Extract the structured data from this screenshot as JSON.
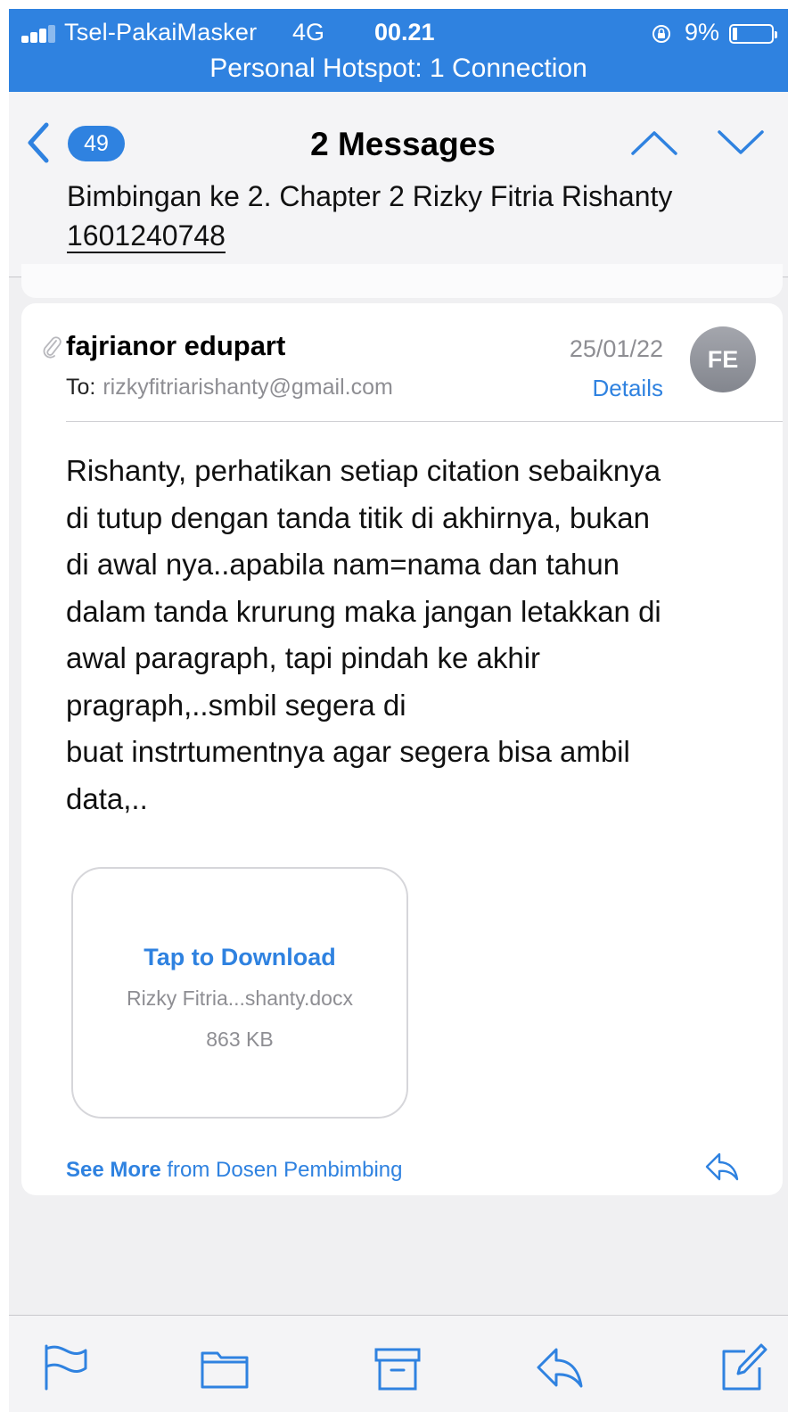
{
  "status_bar": {
    "carrier": "Tsel-PakaiMasker",
    "network": "4G",
    "time": "00.21",
    "battery_percent": "9%",
    "battery_level": 0.09,
    "hotspot": "Personal Hotspot: 1 Connection"
  },
  "nav": {
    "unread_count": "49",
    "title": "2 Messages",
    "subject_text": "Bimbingan ke 2. Chapter 2 Rizky Fitria Rishanty ",
    "subject_link": "1601240748"
  },
  "message": {
    "sender": "fajrianor edupart",
    "date": "25/01/22",
    "to_label": "To:",
    "to_address": "rizkyfitriarishanty@gmail.com",
    "details_label": "Details",
    "avatar_initials": "FE",
    "body": "Rishanty, perhatikan setiap citation sebaiknya\ndi tutup dengan tanda titik di akhirnya, bukan\ndi awal nya..apabila nam=nama dan tahun\ndalam tanda krurung maka jangan letakkan di\nawal paragraph, tapi pindah ke akhir\npragraph,..smbil segera di\nbuat instrtumentnya agar segera bisa ambil\ndata,..",
    "attachment": {
      "action": "Tap to Download",
      "filename": "Rizky Fitria...shanty.docx",
      "size": "863 KB"
    },
    "see_more_bold": "See More",
    "see_more_rest": " from Dosen Pembimbing"
  },
  "colors": {
    "accent": "#2f82e0",
    "secondary_text": "#8e8e93"
  },
  "icons": [
    "signal-icon",
    "orientation-lock-icon",
    "battery-icon",
    "back-chevron-icon",
    "up-chevron-icon",
    "down-chevron-icon",
    "paperclip-icon",
    "reply-icon",
    "flag-icon",
    "folder-icon",
    "archive-icon",
    "compose-icon"
  ]
}
